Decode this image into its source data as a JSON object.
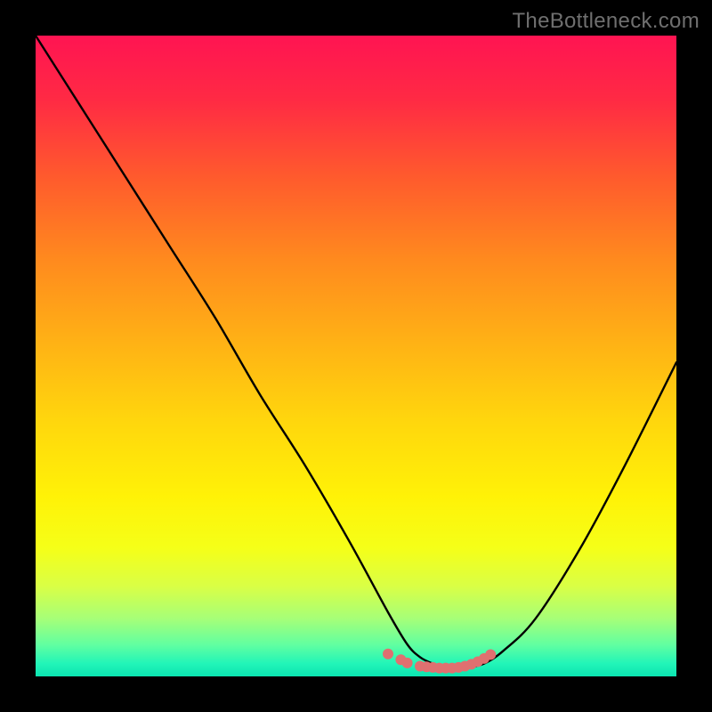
{
  "watermark": "TheBottleneck.com",
  "chart_data": {
    "type": "line",
    "title": "",
    "xlabel": "",
    "ylabel": "",
    "xlim": [
      0,
      100
    ],
    "ylim": [
      0,
      100
    ],
    "grid": false,
    "series": [
      {
        "name": "curve",
        "color": "#000000",
        "x": [
          0,
          7,
          14,
          21,
          28,
          35,
          42,
          49,
          55,
          58,
          60,
          62,
          64,
          66,
          68,
          70,
          73,
          78,
          85,
          92,
          100
        ],
        "values": [
          100,
          89,
          78,
          67,
          56,
          44,
          33,
          21,
          10,
          5,
          3,
          2,
          1.5,
          1.3,
          1.5,
          2,
          4,
          9,
          20,
          33,
          49
        ]
      },
      {
        "name": "basin-dots",
        "color": "#e07070",
        "style": "scatter",
        "x": [
          55,
          57,
          58,
          60,
          61,
          62,
          63,
          64,
          65,
          66,
          67,
          68,
          69,
          70,
          71
        ],
        "values": [
          3.5,
          2.6,
          2.1,
          1.6,
          1.5,
          1.4,
          1.3,
          1.3,
          1.3,
          1.4,
          1.6,
          1.9,
          2.3,
          2.8,
          3.4
        ]
      }
    ],
    "gradient_background": {
      "direction": "top-to-bottom",
      "stops": [
        {
          "pos": 0,
          "color": "#ff1452"
        },
        {
          "pos": 50,
          "color": "#ffc010"
        },
        {
          "pos": 80,
          "color": "#f5ff18"
        },
        {
          "pos": 100,
          "color": "#0be4b1"
        }
      ]
    },
    "frame_color": "#000000"
  }
}
